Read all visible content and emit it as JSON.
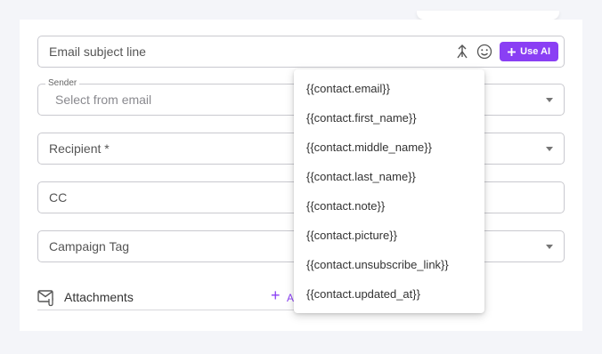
{
  "form": {
    "subject": {
      "placeholder": "Email subject line",
      "ai_button_label": "Use AI"
    },
    "sender": {
      "label": "Sender",
      "placeholder": "Select from email"
    },
    "recipient": {
      "placeholder": "Recipient *"
    },
    "cc": {
      "placeholder": "CC"
    },
    "campaign_tag": {
      "placeholder": "Campaign Tag"
    },
    "attachments": {
      "label": "Attachments",
      "add_label": "A"
    }
  },
  "variable_menu": {
    "items": [
      "{{contact.email}}",
      "{{contact.first_name}}",
      "{{contact.middle_name}}",
      "{{contact.last_name}}",
      "{{contact.note}}",
      "{{contact.picture}}",
      "{{contact.unsubscribe_link}}",
      "{{contact.updated_at}}"
    ]
  },
  "colors": {
    "accent": "#8a3ff4",
    "border": "#c9c9cf",
    "background": "#f4f5f9"
  },
  "icons": {
    "subject_tools": [
      "personalize-icon",
      "emoji-icon",
      "sparkle-icon"
    ],
    "attachments": "attachment-icon",
    "add": "plus-icon",
    "dropdown": "chevron-down-icon"
  }
}
